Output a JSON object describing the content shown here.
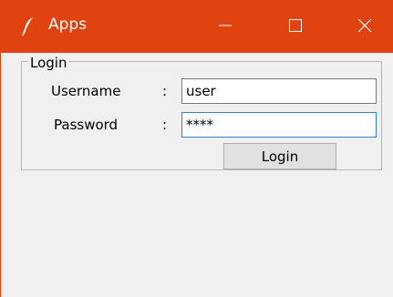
{
  "window": {
    "title": "Apps",
    "accent_color": "#e0430f",
    "icon": "feather-icon"
  },
  "controls": {
    "minimize_icon": "minimize-icon",
    "maximize_icon": "maximize-icon",
    "close_icon": "close-icon"
  },
  "login_frame": {
    "legend": "Login",
    "username_label": "Username",
    "password_label": "Password",
    "separator": ":",
    "username_value": "user",
    "password_value": "****",
    "button_label": "Login"
  }
}
